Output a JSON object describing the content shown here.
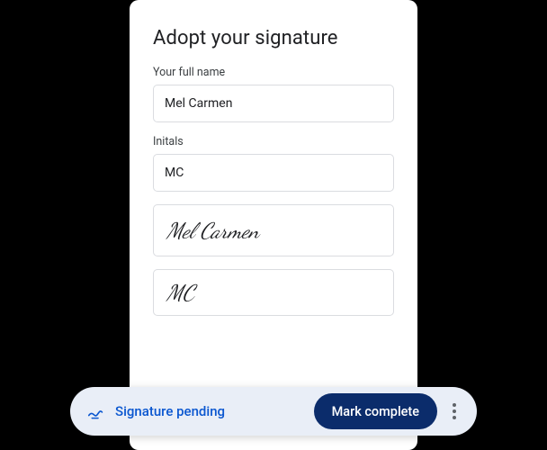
{
  "card": {
    "title": "Adopt your signature",
    "fields": {
      "fullname_label": "Your full name",
      "fullname_value": "Mel Carmen",
      "initials_label": "Initals",
      "initials_value": "MC"
    },
    "signature_preview": "Mel Carmen",
    "initials_preview": "MC"
  },
  "footer": {
    "status_text": "Signature pending",
    "button_label": "Mark complete",
    "icon_name": "signature-pen-icon"
  },
  "colors": {
    "accent": "#0B57D0",
    "button_bg": "#0B2C6B",
    "footer_bg": "#E9EEF7",
    "border": "#dadce0"
  }
}
